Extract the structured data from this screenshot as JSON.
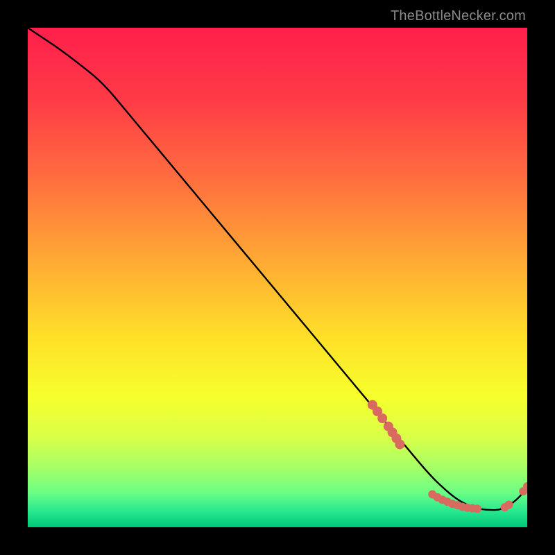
{
  "watermark": "TheBottleNecker.com",
  "chart_data": {
    "type": "line",
    "title": "",
    "xlabel": "",
    "ylabel": "",
    "xlim": [
      0,
      100
    ],
    "ylim": [
      0,
      100
    ],
    "grid": false,
    "legend": false,
    "background_gradient_stops": [
      {
        "pct": 0,
        "color": "#ff1f4b"
      },
      {
        "pct": 14,
        "color": "#ff3a47"
      },
      {
        "pct": 30,
        "color": "#ff6d3f"
      },
      {
        "pct": 48,
        "color": "#ffae33"
      },
      {
        "pct": 62,
        "color": "#ffe028"
      },
      {
        "pct": 74,
        "color": "#f6ff2c"
      },
      {
        "pct": 82,
        "color": "#d9ff49"
      },
      {
        "pct": 88,
        "color": "#a7ff66"
      },
      {
        "pct": 93,
        "color": "#6cff85"
      },
      {
        "pct": 97,
        "color": "#25e68f"
      },
      {
        "pct": 100,
        "color": "#00c776"
      }
    ],
    "series": [
      {
        "name": "bottleneck-curve",
        "color": "#000000",
        "x": [
          0,
          3,
          6,
          10,
          15,
          20,
          25,
          30,
          35,
          40,
          45,
          50,
          55,
          60,
          65,
          70,
          75,
          80,
          83,
          86,
          89,
          92,
          95,
          98,
          100
        ],
        "y": [
          100,
          98,
          96,
          93,
          89,
          83,
          77,
          71,
          65,
          59,
          53,
          47,
          41,
          35,
          29,
          23,
          17,
          11,
          8,
          5.5,
          4,
          3.4,
          3.5,
          5.5,
          8
        ]
      }
    ],
    "clusters": [
      {
        "name": "cluster-a",
        "color": "#d86a60",
        "points": [
          {
            "x": 69.0,
            "y": 24.5
          },
          {
            "x": 70.0,
            "y": 23.2
          },
          {
            "x": 71.0,
            "y": 21.8
          },
          {
            "x": 72.2,
            "y": 20.2
          },
          {
            "x": 73.0,
            "y": 19.0
          },
          {
            "x": 73.8,
            "y": 17.8
          },
          {
            "x": 74.5,
            "y": 16.6
          }
        ],
        "radius": 7
      },
      {
        "name": "cluster-b",
        "color": "#d86a60",
        "points": [
          {
            "x": 81.0,
            "y": 6.6
          },
          {
            "x": 82.0,
            "y": 6.0
          },
          {
            "x": 83.0,
            "y": 5.5
          },
          {
            "x": 84.0,
            "y": 5.1
          },
          {
            "x": 85.0,
            "y": 4.7
          },
          {
            "x": 86.0,
            "y": 4.4
          },
          {
            "x": 87.0,
            "y": 4.1
          },
          {
            "x": 88.0,
            "y": 3.9
          },
          {
            "x": 89.0,
            "y": 3.8
          },
          {
            "x": 90.0,
            "y": 3.7
          }
        ],
        "radius": 6
      },
      {
        "name": "cluster-c",
        "color": "#d86a60",
        "points": [
          {
            "x": 95.5,
            "y": 4.0
          },
          {
            "x": 96.3,
            "y": 4.5
          }
        ],
        "radius": 6
      },
      {
        "name": "cluster-d",
        "color": "#d86a60",
        "points": [
          {
            "x": 99.2,
            "y": 7.2
          },
          {
            "x": 100.0,
            "y": 8.2
          }
        ],
        "radius": 6
      }
    ],
    "annotations": [
      {
        "name": "tiny-label",
        "x": 85.5,
        "y": 5.2,
        "text": "",
        "color": "#d86a60"
      }
    ]
  }
}
